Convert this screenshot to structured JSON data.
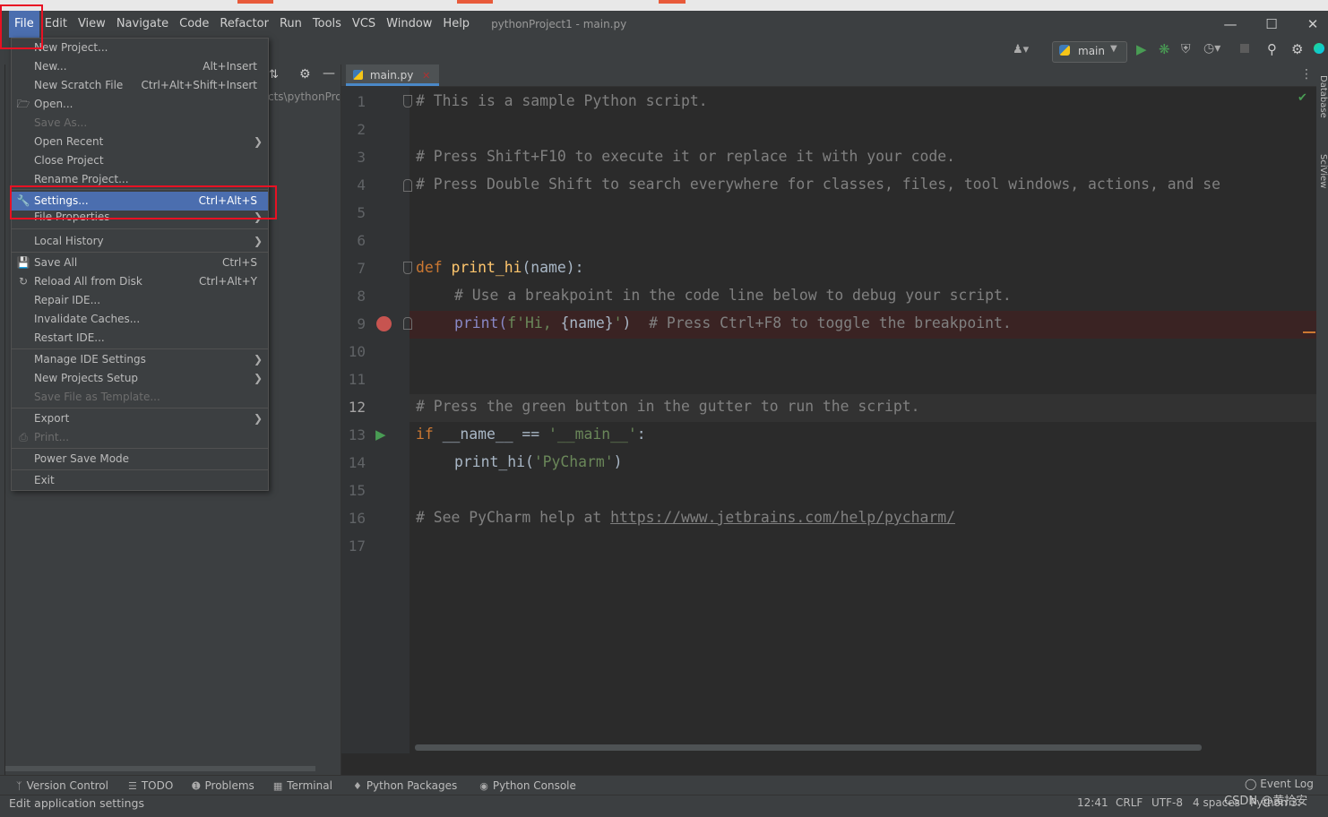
{
  "menubar": {
    "items": [
      "File",
      "Edit",
      "View",
      "Navigate",
      "Code",
      "Refactor",
      "Run",
      "Tools",
      "VCS",
      "Window",
      "Help"
    ],
    "window_title": "pythonProject1 - main.py"
  },
  "toolbar": {
    "run_config": "main"
  },
  "project_panel": {
    "path_fragment": "cts\\pythonPro"
  },
  "editor": {
    "tab_label": "main.py",
    "line_numbers": [
      "1",
      "2",
      "3",
      "4",
      "5",
      "6",
      "7",
      "8",
      "9",
      "10",
      "11",
      "12",
      "13",
      "14",
      "15",
      "16",
      "17"
    ],
    "lines": {
      "l1": "# This is a sample Python script.",
      "l3": "# Press Shift+F10 to execute it or replace it with your code.",
      "l4": "# Press Double Shift to search everywhere for classes, files, tool windows, actions, and se",
      "l7_kw": "def",
      "l7_fn": "print_hi",
      "l7_rest": "(name):",
      "l8": "# Use a breakpoint in the code line below to debug your script.",
      "l9_call": "print(",
      "l9_str1": "f'Hi, ",
      "l9_expr": "{name}",
      "l9_str2": "'",
      "l9_close": ")",
      "l9_cmt": "# Press Ctrl+F8 to toggle the breakpoint.",
      "l12": "# Press the green button in the gutter to run the script.",
      "l13_kw": "if",
      "l13_mid": " __name__ == ",
      "l13_str": "'__main__'",
      "l13_end": ":",
      "l14_call": "print_hi(",
      "l14_str": "'PyCharm'",
      "l14_end": ")",
      "l16_cmt": "# See PyCharm help at ",
      "l16_link": "https://www.jetbrains.com/help/pycharm/"
    }
  },
  "file_menu": {
    "new_project": "New Project...",
    "new": "New...",
    "new_sc": "Alt+Insert",
    "new_scratch": "New Scratch File",
    "new_scratch_sc": "Ctrl+Alt+Shift+Insert",
    "open": "Open...",
    "save_as": "Save As...",
    "open_recent": "Open Recent",
    "close_project": "Close Project",
    "rename_project": "Rename Project...",
    "settings": "Settings...",
    "settings_sc": "Ctrl+Alt+S",
    "file_properties": "File Properties",
    "local_history": "Local History",
    "save_all": "Save All",
    "save_all_sc": "Ctrl+S",
    "reload": "Reload All from Disk",
    "reload_sc": "Ctrl+Alt+Y",
    "repair_ide": "Repair IDE...",
    "invalidate": "Invalidate Caches...",
    "restart": "Restart IDE...",
    "manage_ide": "Manage IDE Settings",
    "new_projects_setup": "New Projects Setup",
    "save_template": "Save File as Template...",
    "export": "Export",
    "print": "Print...",
    "power_save": "Power Save Mode",
    "exit": "Exit"
  },
  "toolwindows": [
    "Version Control",
    "TODO",
    "Problems",
    "Terminal",
    "Python Packages",
    "Python Console"
  ],
  "event_log": "Event Log",
  "right_tabs": [
    "Database",
    "SciView"
  ],
  "statusbar": {
    "message": "Edit application settings",
    "position": "12:41",
    "line_sep": "CRLF",
    "encoding": "UTF-8",
    "indent": "4 spaces",
    "interpreter": "Python 3.",
    "watermark": "CSDN @黄拾安"
  },
  "colors": {
    "accent": "#4b6eaf",
    "highlight_box": "#e81123",
    "breakpoint": "#c75450",
    "run": "#499c54"
  }
}
